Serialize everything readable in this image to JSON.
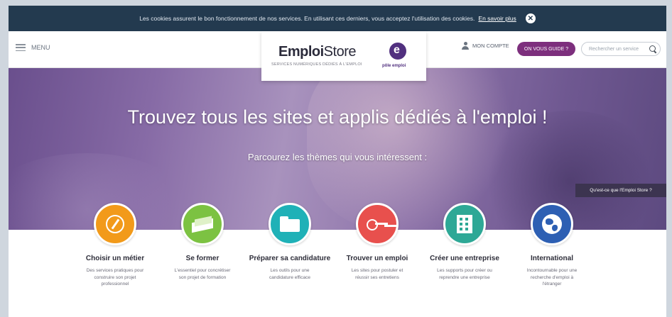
{
  "colors": {
    "cookie_bar": "#233a4f",
    "join_button": "#7d2f7d",
    "pole_emploi": "#51307f",
    "theme_orange": "#f29a1a",
    "theme_green": "#7cc242",
    "theme_teal": "#1fb1b7",
    "theme_red": "#e8504d",
    "theme_emerald": "#2ea896",
    "theme_blue": "#2d5fb3"
  },
  "cookie": {
    "text": "Les cookies assurent le bon fonctionnement de nos services. En utilisant ces derniers, vous acceptez l'utilisation des cookies.",
    "link": "En savoir plus",
    "close_icon": "close-icon"
  },
  "header": {
    "menu_label": "MENU",
    "logo_emploi": "Emploi",
    "logo_store": "Store",
    "logo_tagline": "SERVICES NUMÉRIQUES DÉDIÉS À L'EMPLOI",
    "pole_emploi": "pôle emploi",
    "account_label": "MON COMPTE",
    "join_label": "ON VOUS GUIDE ?",
    "search_placeholder": "Rechercher un service"
  },
  "hero": {
    "title": "Trouvez tous les sites et applis dédiés à l'emploi !",
    "subtitle": "Parcourez les thèmes qui vous intéressent :",
    "what_is_button": "Qu'est-ce que l'Emploi Store ?"
  },
  "themes": [
    {
      "title": "Choisir un métier",
      "desc": "Des services pratiques pour construire son projet professionnel",
      "icon": "compass-icon"
    },
    {
      "title": "Se former",
      "desc": "L'essentiel pour concrétiser son projet de formation",
      "icon": "book-icon"
    },
    {
      "title": "Préparer sa candidature",
      "desc": "Les outils pour une candidature efficace",
      "icon": "folder-icon"
    },
    {
      "title": "Trouver un emploi",
      "desc": "Les sites pour postuler et réussir ses entretiens",
      "icon": "key-icon"
    },
    {
      "title": "Créer une entreprise",
      "desc": "Les supports pour créer ou reprendre une entreprise",
      "icon": "building-icon"
    },
    {
      "title": "International",
      "desc": "Incontournable pour une recherche d'emploi à l'étranger",
      "icon": "globe-icon"
    }
  ]
}
